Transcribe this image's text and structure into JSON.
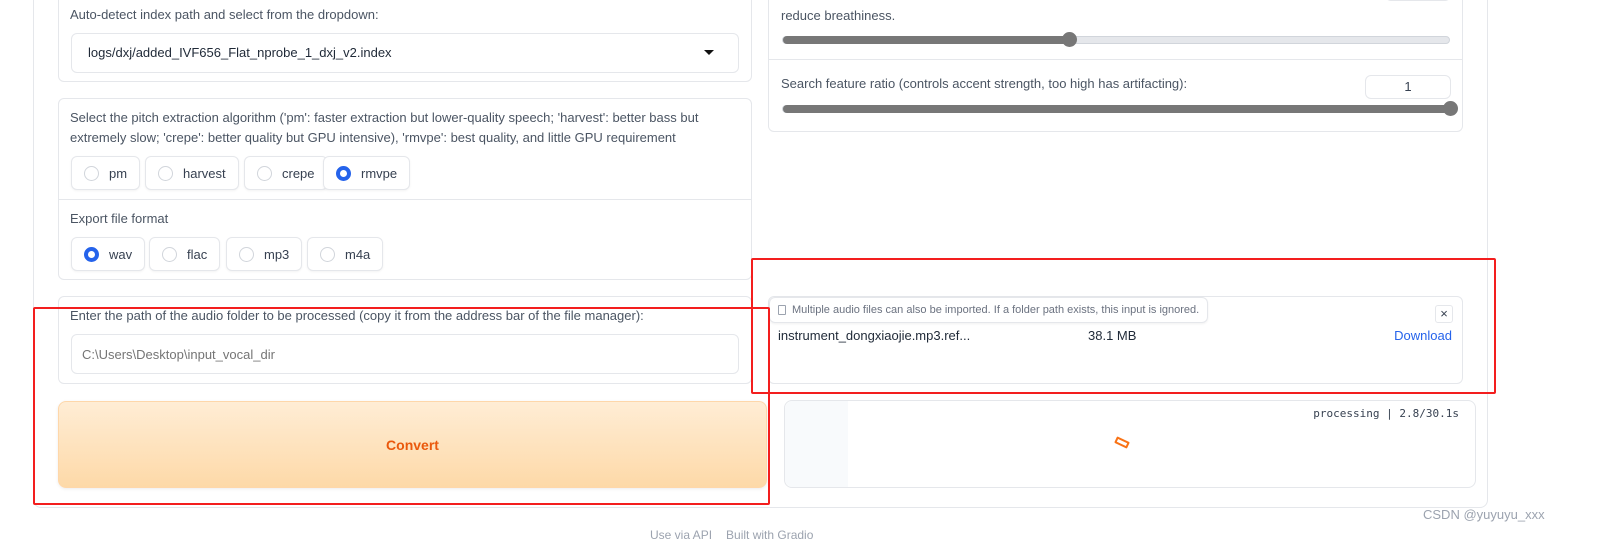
{
  "left": {
    "index": {
      "label": "Auto-detect index path and select from the dropdown:",
      "value": "logs/dxj/added_IVF656_Flat_nprobe_1_dxj_v2.index"
    },
    "pitch": {
      "label": "Select the pitch extraction algorithm ('pm': faster extraction but lower-quality speech; 'harvest': better bass but extremely slow; 'crepe': better quality but GPU intensive), 'rmvpe': best quality, and little GPU requirement",
      "options": [
        "pm",
        "harvest",
        "crepe",
        "rmvpe"
      ],
      "selected": "rmvpe"
    },
    "format": {
      "label": "Export file format",
      "options": [
        "wav",
        "flac",
        "mp3",
        "m4a"
      ],
      "selected": "wav"
    },
    "folder": {
      "label": "Enter the path of the audio folder to be processed (copy it from the address bar of the file manager):",
      "placeholder": "C:\\Users\\Desktop\\input_vocal_dir"
    },
    "convert_label": "Convert"
  },
  "right": {
    "breath": {
      "label": "reduce breathiness.",
      "value_fraction": 0.43
    },
    "feature": {
      "label": "Search feature ratio (controls accent strength, too high has artifacting):",
      "value": "1",
      "value_fraction": 1.0
    },
    "upload": {
      "tooltip": "Multiple audio files can also be imported. If a folder path exists, this input is ignored.",
      "file_name": "instrument_dongxiaojie.mp3.ref...",
      "file_size": "38.1 MB",
      "download_label": "Download"
    },
    "progress": {
      "status": "processing | 2.8/30.1s"
    }
  },
  "footer": {
    "api": "Use via API",
    "built": "Built with Gradio"
  },
  "watermark": "CSDN @yuyuyu_xxx",
  "colors": {
    "accent": "#2563eb",
    "convert_text": "#ea580c",
    "annotation": "#f31e1e"
  }
}
